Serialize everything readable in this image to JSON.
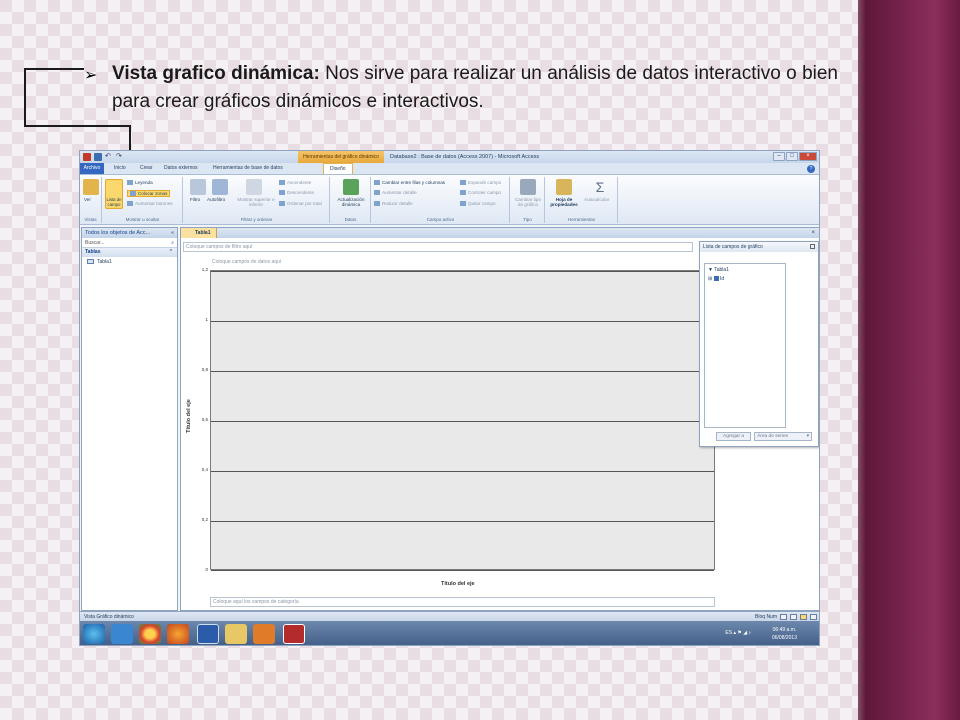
{
  "slide": {
    "heading": "Vista grafico dinámica:",
    "text": " Nos sirve para realizar un análisis de datos interactivo o bien para crear gráficos dinámicos e interactivos."
  },
  "window": {
    "context_tab": "Herramientas del gráfico dinámico",
    "title": "Database2 : Base de datos (Access 2007) - Microsoft Access",
    "tabs": [
      "Archivo",
      "Inicio",
      "Crear",
      "Datos externos",
      "Herramientas de base de datos",
      "Diseño"
    ]
  },
  "ribbon": {
    "ver": "Ver",
    "lista_de_campos": "Lista de campo",
    "leyenda": "Leyenda",
    "colocar_zonas": "Colocar zonas",
    "aumentar_botones": "Aumentar botones",
    "filtro": "Filtro",
    "autofiltro": "Autofiltro",
    "mostrar_superior": "Mostrar superior e inferior",
    "ascendente": "Ascendente",
    "descendente": "Descendente",
    "ordenar_por_total": "Ordenar por total",
    "actualizacion": "Actualización dinámica",
    "cambiar_filas": "Cambiar entre filas y columnas",
    "aumentar_detalle": "Aumentar detalle",
    "reducir_detalle": "Reducir detalle",
    "expandir_campo": "Expandir campo",
    "contraer_campo": "Contraer campo",
    "quitar_campo": "Quitar campo",
    "cambiar_tipo": "Cambiar tipo de gráfico",
    "hoja_propiedades": "Hoja de propiedades",
    "autocalcular": "Autocalcular",
    "groups": {
      "vistas": "Vistas",
      "mostrar": "Mostrar u ocultar",
      "filtrar": "Filtrar y ordenar",
      "datos": "Datos",
      "campo": "Campo activo",
      "tipo": "Tipo",
      "herramientas": "Herramientas"
    }
  },
  "nav": {
    "header": "Todos los objetos de Acc...",
    "search_placeholder": "Buscar...",
    "section": "Tablas",
    "items": [
      "Tabla1"
    ]
  },
  "doc": {
    "tab": "Tabla1",
    "filter_zone": "Coloque campos de filtro aquí",
    "data_zone": "Coloque campos de datos aquí",
    "category_zone": "Coloque aquí los campos de categoría",
    "y_axis_title": "Título del eje",
    "x_axis_title": "Título del eje"
  },
  "chart_data": {
    "type": "bar",
    "categories": [],
    "series": [],
    "ylim": [
      0,
      1.2
    ],
    "yticks": [
      "0",
      "0,2",
      "0,4",
      "0,6",
      "0,8",
      "1",
      "1,2"
    ],
    "ylabel": "Título del eje",
    "xlabel": "Título del eje",
    "grid": true
  },
  "field_list": {
    "title": "Lista de campos de gráfico",
    "table": "Tabla1",
    "field": "Id",
    "add_button": "Agregar a",
    "area_select": "Área de series"
  },
  "status": {
    "left": "Vista Gráfico dinámico",
    "right": "Bloq Num"
  },
  "taskbar": {
    "lang": "ES",
    "time": "06:49 a.m.",
    "date": "06/08/2013"
  }
}
